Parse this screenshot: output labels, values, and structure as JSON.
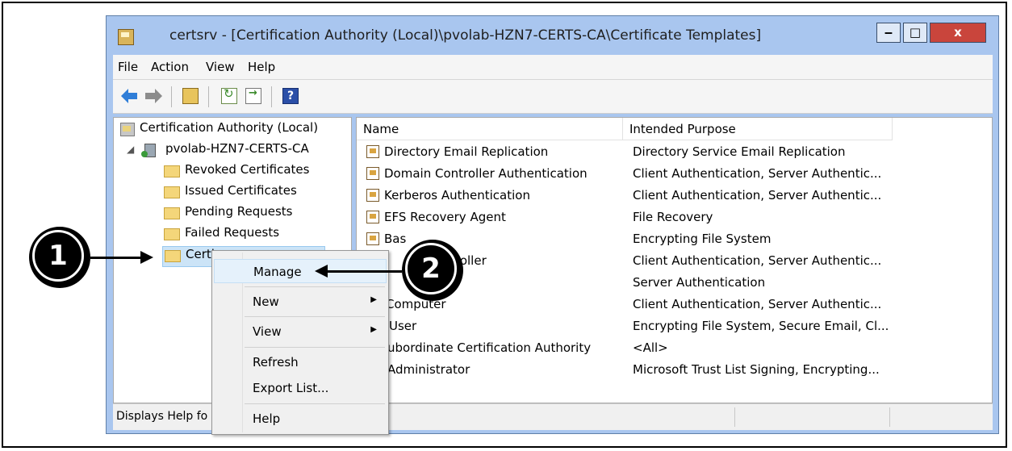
{
  "window": {
    "title": "certsrv - [Certification Authority (Local)\\pvolab-HZN7-CERTS-CA\\Certificate Templates]",
    "buttons": {
      "minimize": "‒",
      "maximize": "□",
      "close": "x"
    }
  },
  "menubar": {
    "items": [
      "File",
      "Action",
      "View",
      "Help"
    ]
  },
  "toolbar": {
    "help_label": "?"
  },
  "tree": {
    "root": "Certification Authority (Local)",
    "ca": "pvolab-HZN7-CERTS-CA",
    "items": [
      "Revoked Certificates",
      "Issued Certificates",
      "Pending Requests",
      "Failed Requests",
      "Certificate Templates"
    ],
    "selected_item_visible": "Certi"
  },
  "list": {
    "columns": [
      "Name",
      "Intended Purpose"
    ],
    "rows": [
      {
        "name": "Directory Email Replication",
        "purpose": "Directory Service Email Replication"
      },
      {
        "name": "Domain Controller Authentication",
        "purpose": "Client Authentication, Server Authentic..."
      },
      {
        "name": "Kerberos Authentication",
        "purpose": "Client Authentication, Server Authentic..."
      },
      {
        "name": "EFS Recovery Agent",
        "purpose": "File Recovery"
      },
      {
        "name": "Bas",
        "purpose": "Encrypting File System"
      },
      {
        "name": "roller",
        "purpose": "Client Authentication, Server Authentic..."
      },
      {
        "name": "",
        "purpose": "Server Authentication"
      },
      {
        "name": "Computer",
        "purpose": "Client Authentication, Server Authentic..."
      },
      {
        "name": "User",
        "purpose": "Encrypting File System, Secure Email, Cl..."
      },
      {
        "name": "ubordinate Certification Authority",
        "purpose": "<All>"
      },
      {
        "name": "Administrator",
        "purpose": "Microsoft Trust List Signing, Encrypting..."
      }
    ]
  },
  "statusbar": {
    "text": "Displays Help fo"
  },
  "context_menu": {
    "items": [
      "Manage",
      "New",
      "View",
      "Refresh",
      "Export List...",
      "Help"
    ],
    "submenu_arrow": "▶"
  },
  "callouts": {
    "one": "1",
    "two": "2"
  },
  "colors": {
    "titlebar": "#a9c6ef",
    "close_button": "#c9453c",
    "selection": "#cce4f7"
  }
}
